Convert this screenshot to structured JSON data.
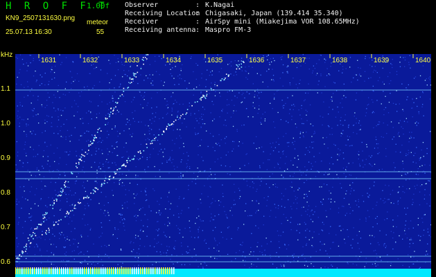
{
  "header": {
    "logo": "H R O F F T",
    "version": "1.00f",
    "filename": "KN9_2507131630.png",
    "meteor_label": "meteor",
    "datetime": "25.07.13 16:30",
    "count": "55",
    "info": [
      {
        "key": "Observer",
        "value": "K.Nagai"
      },
      {
        "key": "Receiving Location",
        "value": "Chigasaki, Japan (139.414 35.340)"
      },
      {
        "key": "Receiver",
        "value": "AirSpy mini (Miakejima VOR 108.65MHz)"
      },
      {
        "key": "Receiving antenna",
        "value": "Maspro FM-3"
      }
    ]
  },
  "plot": {
    "y_unit": "kHz",
    "y_ticks": [
      "1.1",
      "1.0",
      "0.9",
      "0.8",
      "0.7",
      "0.6"
    ],
    "x_ticks": [
      "1631",
      "1632",
      "1633",
      "1634",
      "1635",
      "1636",
      "1637",
      "1638",
      "1639",
      "1640"
    ]
  },
  "colors": {
    "background": "#000000",
    "logo": "#00e000",
    "labels": "#ffff40",
    "info_text": "#f0f0f0",
    "spectrum": "#0a1a9a",
    "signal": "#ffffff"
  }
}
